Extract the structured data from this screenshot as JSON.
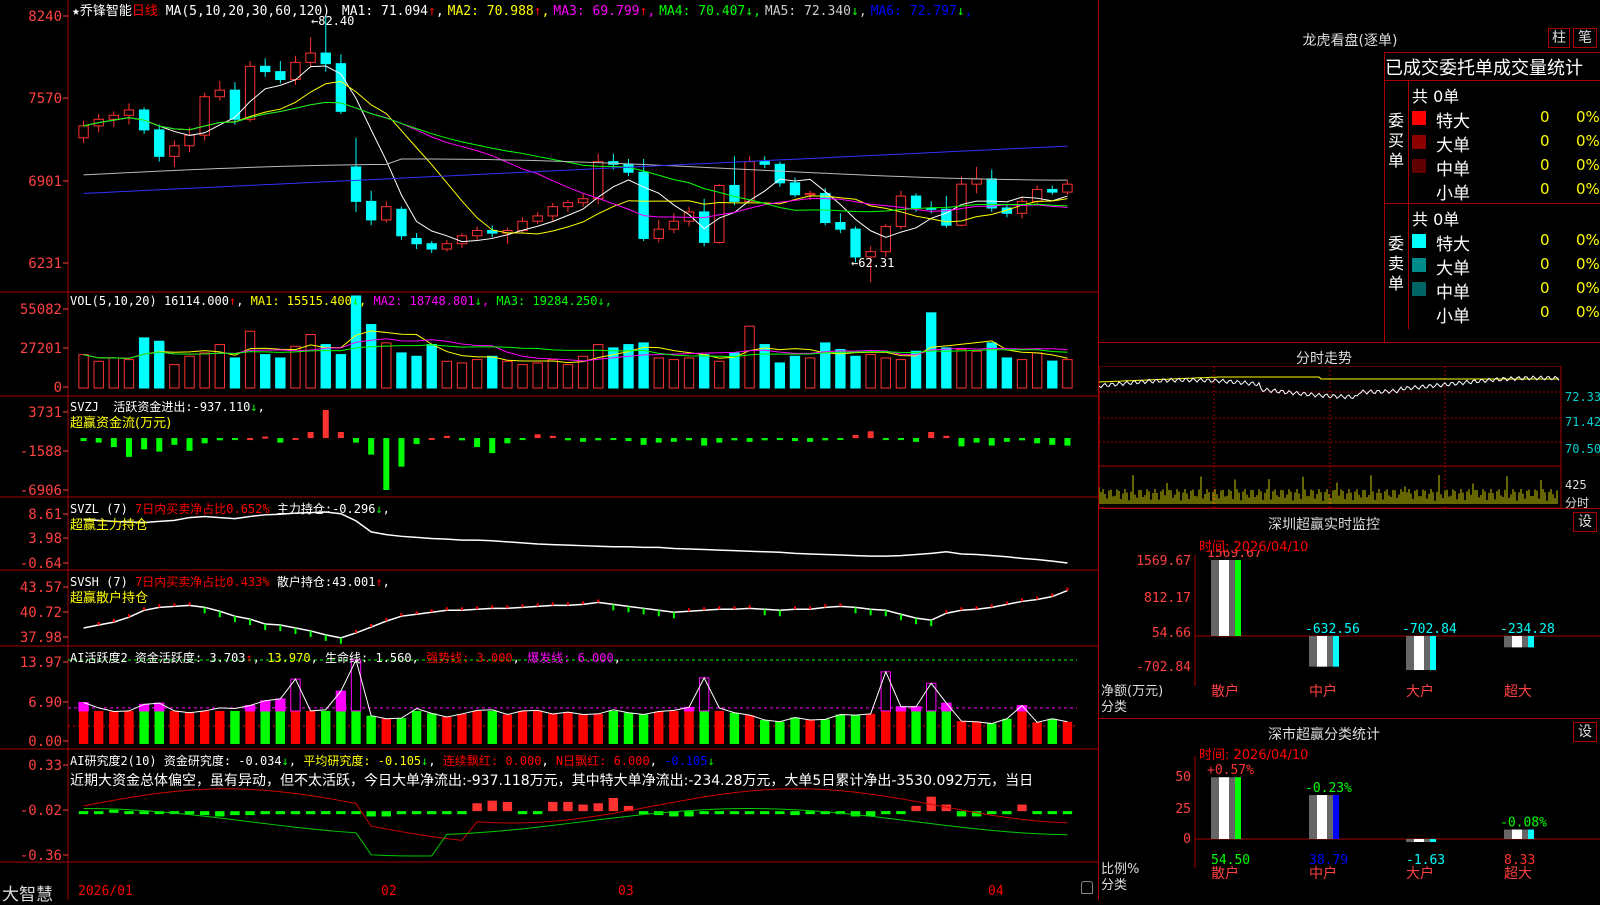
{
  "stock": {
    "name": "乔锋智能",
    "period": "日线",
    "star": "★",
    "ma_label": "MA(5,10,20,30,60,120)"
  },
  "ma": [
    {
      "label": "MA1:",
      "value": "71.094",
      "arrow": "↑",
      "color": "#ffffff"
    },
    {
      "label": "MA2:",
      "value": "70.988",
      "arrow": "↑",
      "color": "#ffff00"
    },
    {
      "label": "MA3:",
      "value": "69.799",
      "arrow": "↑",
      "color": "#ff00ff"
    },
    {
      "label": "MA4:",
      "value": "70.407",
      "arrow": "↓",
      "color": "#00ff00"
    },
    {
      "label": "MA5:",
      "value": "72.340",
      "arrow": "↓",
      "color": "#cccccc"
    },
    {
      "label": "MA6:",
      "value": "72.797",
      "arrow": "↓",
      "color": "#0000ff"
    }
  ],
  "price_axis": [
    "8240",
    "7570",
    "6901",
    "6231"
  ],
  "price_marks": {
    "high": "82.40",
    "low": "62.31"
  },
  "vol": {
    "label": "VOL(5,10,20)",
    "value": "16114.000",
    "arrow": "↑",
    "ma": [
      {
        "t": "MA1:",
        "v": "15515.400",
        "a": "↓",
        "c": "#ffff00"
      },
      {
        "t": "MA2:",
        "v": "18748.801",
        "a": "↓",
        "c": "#ff00ff"
      },
      {
        "t": "MA3:",
        "v": "19284.250",
        "a": "↓",
        "c": "#00ff00"
      }
    ],
    "axis": [
      "55082",
      "27201",
      "0"
    ]
  },
  "svzj": {
    "label": "SVZJ",
    "text": "活跃资金进出:",
    "value": "-937.110",
    "arrow": "↓",
    "sub": "超赢资金流(万元)",
    "axis": [
      "3731",
      "-1588",
      "-6906"
    ]
  },
  "svzl": {
    "label": "SVZL (7)",
    "ratio": "7日内买卖净占比0.652%",
    "text": "主力持仓:",
    "value": "-0.296",
    "arrow": "↓",
    "sub": "超赢主力持仓",
    "axis": [
      "8.61",
      "3.98",
      "-0.64"
    ]
  },
  "svsh": {
    "label": "SVSH (7)",
    "ratio": "7日内买卖净占比0.433%",
    "text": "散户持仓:",
    "value": "43.001",
    "arrow": "↑",
    "sub": "超赢散户持仓",
    "axis": [
      "43.57",
      "40.72",
      "37.98"
    ]
  },
  "ai_active": {
    "label": "AI活跃度2",
    "text": "资金活跃度:",
    "value": "3.703",
    "arrow": "↑",
    "v2": "13.970",
    "life": "生命线:",
    "life_v": "1.560",
    "strong": "强势线:",
    "strong_v": "3.000",
    "burst": "爆发线:",
    "burst_v": "6.000",
    "axis": [
      "13.97",
      "6.90",
      "0.00"
    ]
  },
  "ai_research": {
    "label": "AI研究度2(10)",
    "text": "资金研究度:",
    "value": "-0.034",
    "arrow": "↓",
    "avg": "平均研究度:",
    "avg_v": "-0.105",
    "red": "连续飘红:",
    "red_v": "0.000",
    "nred": "N日飘红:",
    "nred_v": "6.000",
    "extra": "-0.105",
    "commentary": "近期大资金总体偏空，虽有异动，但不太活跃，今日大单净流出:-937.118万元，其中特大单净流出:-234.28万元，大单5日累计净出-3530.092万元，当日",
    "axis": [
      "0.33",
      "-0.02",
      "-0.36"
    ]
  },
  "bottom": {
    "brand": "大智慧",
    "dates": [
      "2026/01",
      "02",
      "03",
      "04"
    ]
  },
  "panel": {
    "title": "龙虎看盘(逐单)",
    "tab_bar": "柱",
    "tab_pen": "笔",
    "header": "已成交委托单成交量统计",
    "buy": {
      "side": "委买单",
      "total": "共 0单",
      "rows": [
        {
          "name": "特大",
          "count": "0",
          "pct": "0%",
          "color": "#ff0000"
        },
        {
          "name": "大单",
          "count": "0",
          "pct": "0%",
          "color": "#8b0000"
        },
        {
          "name": "中单",
          "count": "0",
          "pct": "0%",
          "color": "#600000"
        },
        {
          "name": "小单",
          "count": "0",
          "pct": "0%",
          "color": "#000000"
        }
      ]
    },
    "sell": {
      "side": "委卖单",
      "total": "共 0单",
      "rows": [
        {
          "name": "特大",
          "count": "0",
          "pct": "0%",
          "color": "#00ffff"
        },
        {
          "name": "大单",
          "count": "0",
          "pct": "0%",
          "color": "#008b8b"
        },
        {
          "name": "中单",
          "count": "0",
          "pct": "0%",
          "color": "#006464"
        },
        {
          "name": "小单",
          "count": "0",
          "pct": "0%",
          "color": "#000000"
        }
      ]
    }
  },
  "intraday": {
    "title": "分时走势",
    "axis": [
      "72.33",
      "71.42",
      "70.50"
    ],
    "vol_label": "425",
    "vol_unit": "分时"
  },
  "sz_monitor": {
    "title": "深圳超赢实时监控",
    "set": "设",
    "time_label": "时间: 2026/04/10",
    "axis": [
      "1569.67",
      "812.17",
      "54.66",
      "-702.84"
    ],
    "unit": "净额(万元)",
    "cat": "分类",
    "bars": [
      {
        "cat": "散户",
        "value": "1569.67"
      },
      {
        "cat": "中户",
        "value": "-632.56"
      },
      {
        "cat": "大户",
        "value": "-702.84"
      },
      {
        "cat": "超大",
        "value": "-234.28"
      }
    ]
  },
  "sz_class": {
    "title": "深市超赢分类统计",
    "set": "设",
    "time_label": "时间: 2026/04/10",
    "axis": [
      "75",
      "50",
      "25",
      "0"
    ],
    "unit": "比例%",
    "cat": "分类",
    "bars": [
      {
        "cat": "散户",
        "value": "54.50",
        "change": "+0.57%"
      },
      {
        "cat": "中户",
        "value": "38.79",
        "change": "-0.23%"
      },
      {
        "cat": "大户",
        "value": "-1.63",
        "change": ""
      },
      {
        "cat": "超大",
        "value": "8.33",
        "change": "-0.08%"
      }
    ]
  },
  "chart_data": [
    {
      "type": "candlestick",
      "title": "乔锋智能 日线",
      "ylim": [
        62.31,
        82.4
      ],
      "ohlc": [
        [
          73.2,
          74.5,
          72.8,
          74.1
        ],
        [
          74.1,
          75.0,
          73.6,
          74.6
        ],
        [
          74.6,
          75.2,
          74.0,
          74.9
        ],
        [
          74.9,
          75.8,
          74.2,
          75.3
        ],
        [
          75.3,
          75.5,
          73.5,
          73.8
        ],
        [
          73.8,
          74.2,
          71.4,
          71.8
        ],
        [
          71.8,
          73.0,
          71.0,
          72.6
        ],
        [
          72.6,
          74.0,
          72.1,
          73.4
        ],
        [
          73.4,
          76.6,
          73.0,
          76.3
        ],
        [
          76.3,
          77.5,
          76.0,
          76.8
        ],
        [
          76.8,
          77.4,
          74.2,
          74.6
        ],
        [
          74.6,
          79.0,
          74.4,
          78.6
        ],
        [
          78.6,
          79.2,
          77.8,
          78.2
        ],
        [
          78.2,
          79.0,
          77.3,
          77.6
        ],
        [
          77.6,
          79.4,
          77.2,
          78.9
        ],
        [
          78.9,
          80.8,
          78.5,
          79.6
        ],
        [
          79.6,
          82.4,
          78.2,
          78.8
        ],
        [
          78.8,
          79.5,
          75.0,
          75.2
        ],
        [
          71.0,
          73.2,
          67.6,
          68.4
        ],
        [
          68.4,
          69.2,
          66.6,
          67.0
        ],
        [
          67.0,
          68.4,
          66.8,
          68.0
        ],
        [
          67.8,
          68.0,
          65.5,
          65.8
        ],
        [
          65.6,
          66.0,
          64.8,
          65.2
        ],
        [
          65.2,
          65.4,
          64.5,
          64.8
        ],
        [
          64.8,
          65.5,
          64.6,
          65.2
        ],
        [
          65.2,
          66.0,
          64.9,
          65.8
        ],
        [
          65.8,
          66.5,
          65.5,
          66.2
        ],
        [
          66.2,
          66.6,
          65.7,
          66.0
        ],
        [
          66.0,
          66.4,
          65.2,
          66.2
        ],
        [
          66.2,
          67.2,
          66.0,
          66.9
        ],
        [
          66.9,
          67.6,
          66.7,
          67.3
        ],
        [
          67.3,
          68.3,
          66.9,
          68.0
        ],
        [
          68.0,
          68.5,
          67.6,
          68.3
        ],
        [
          68.3,
          69.0,
          68.0,
          68.6
        ],
        [
          68.6,
          72.0,
          68.2,
          71.4
        ],
        [
          71.4,
          72.0,
          70.8,
          71.2
        ],
        [
          71.2,
          71.6,
          70.3,
          70.6
        ],
        [
          70.6,
          71.6,
          65.4,
          65.6
        ],
        [
          65.6,
          67.0,
          65.3,
          66.3
        ],
        [
          66.3,
          67.5,
          66.0,
          66.9
        ],
        [
          66.9,
          68.0,
          66.5,
          67.6
        ],
        [
          67.6,
          68.6,
          65.0,
          65.3
        ],
        [
          65.3,
          69.7,
          65.2,
          69.6
        ],
        [
          69.6,
          71.8,
          68.1,
          68.4
        ],
        [
          68.4,
          71.8,
          68.6,
          71.4
        ],
        [
          71.4,
          71.8,
          70.9,
          71.2
        ],
        [
          71.2,
          71.4,
          69.5,
          69.8
        ],
        [
          69.8,
          70.2,
          68.7,
          68.9
        ],
        [
          68.9,
          69.2,
          68.5,
          69.0
        ],
        [
          69.0,
          69.4,
          66.6,
          66.8
        ],
        [
          66.8,
          67.5,
          66.0,
          66.3
        ],
        [
          66.3,
          66.5,
          63.8,
          64.2
        ],
        [
          64.2,
          65.0,
          62.31,
          64.6
        ],
        [
          64.6,
          66.7,
          64.2,
          66.5
        ],
        [
          66.5,
          69.2,
          66.3,
          68.8
        ],
        [
          68.8,
          69.0,
          67.6,
          67.9
        ],
        [
          67.9,
          68.4,
          67.5,
          67.8
        ],
        [
          67.8,
          68.8,
          66.4,
          66.6
        ],
        [
          66.6,
          70.3,
          66.5,
          69.7
        ],
        [
          69.7,
          71.0,
          69.0,
          70.1
        ],
        [
          70.1,
          70.8,
          67.6,
          67.9
        ],
        [
          67.9,
          68.2,
          67.2,
          67.5
        ],
        [
          67.5,
          68.7,
          67.1,
          68.4
        ],
        [
          68.4,
          69.6,
          68.2,
          69.3
        ],
        [
          69.3,
          69.6,
          68.9,
          69.1
        ],
        [
          69.1,
          70.0,
          68.9,
          69.7
        ]
      ]
    },
    {
      "type": "bar",
      "title": "VOL",
      "values": [
        20000,
        16000,
        18000,
        17000,
        30000,
        28000,
        14000,
        19000,
        21000,
        26000,
        18000,
        34000,
        20000,
        18000,
        25000,
        32000,
        26000,
        20000,
        55082,
        38000,
        27000,
        21000,
        19000,
        26000,
        16000,
        15000,
        17000,
        19000,
        16000,
        14000,
        15000,
        17000,
        14000,
        19000,
        26000,
        24000,
        26000,
        27000,
        18000,
        17000,
        18000,
        20000,
        16000,
        21000,
        37000,
        26000,
        15000,
        19000,
        18000,
        27000,
        23000,
        19000,
        20000,
        18000,
        17000,
        22000,
        45000,
        24000,
        23000,
        22000,
        27000,
        18000,
        17000,
        21000,
        16114,
        17000
      ]
    },
    {
      "type": "bar",
      "title": "超赢资金流(万元)",
      "values": [
        -400,
        -600,
        -1200,
        -2500,
        -1500,
        -1800,
        -900,
        -1700,
        -700,
        -300,
        -100,
        0,
        200,
        -600,
        0,
        800,
        3731,
        800,
        -600,
        -2200,
        -6906,
        -3800,
        -800,
        0,
        300,
        -300,
        -1200,
        -2000,
        -700,
        -200,
        500,
        300,
        -300,
        -500,
        -300,
        -200,
        -400,
        -900,
        -600,
        -500,
        -300,
        -1000,
        -600,
        -300,
        -500,
        -300,
        -200,
        -400,
        -500,
        -300,
        -200,
        400,
        900,
        -200,
        -100,
        -500,
        800,
        300,
        -1100,
        -600,
        -1000,
        -500,
        -300,
        -700,
        -900,
        -1000
      ]
    },
    {
      "type": "line",
      "title": "超赢主力持仓",
      "values": [
        7.2,
        7.1,
        6.9,
        6.8,
        6.7,
        6.9,
        7.1,
        7.6,
        7.8,
        7.6,
        7.4,
        7.8,
        8.1,
        8.2,
        8.4,
        8.5,
        8.61,
        8.3,
        7.0,
        5.0,
        4.5,
        4.2,
        4.0,
        3.8,
        3.7,
        3.5,
        3.5,
        3.4,
        3.2,
        3.0,
        2.8,
        2.7,
        2.6,
        2.5,
        2.4,
        2.3,
        2.3,
        2.2,
        2.2,
        2.0,
        1.9,
        1.8,
        1.7,
        1.6,
        1.5,
        1.4,
        1.3,
        1.1,
        1.0,
        0.9,
        0.8,
        0.7,
        0.6,
        0.6,
        0.7,
        0.9,
        1.1,
        1.4,
        1.0,
        0.9,
        0.7,
        0.5,
        0.2,
        0.0,
        -0.3,
        -0.64
      ]
    },
    {
      "type": "line",
      "title": "超赢散户持仓",
      "values": [
        39.2,
        39.5,
        39.8,
        40.3,
        41.0,
        41.3,
        41.4,
        41.5,
        41.3,
        40.9,
        40.4,
        40.1,
        39.6,
        39.5,
        39.2,
        38.9,
        38.5,
        38.2,
        38.7,
        39.3,
        39.9,
        40.4,
        40.6,
        40.8,
        41.0,
        41.0,
        41.1,
        41.2,
        41.2,
        41.3,
        41.4,
        41.5,
        41.5,
        41.6,
        41.8,
        41.6,
        41.4,
        41.2,
        41.0,
        40.8,
        40.9,
        41.0,
        41.1,
        41.1,
        41.2,
        41.1,
        41.0,
        41.1,
        41.1,
        41.3,
        41.4,
        41.3,
        41.1,
        41.0,
        40.6,
        40.2,
        40.0,
        40.7,
        41.0,
        41.1,
        41.3,
        41.6,
        41.9,
        42.1,
        42.4,
        43.0
      ]
    },
    {
      "type": "bar",
      "title": "资金活跃度",
      "values": [
        6.9,
        6.0,
        5.4,
        5.5,
        6.6,
        6.8,
        5.5,
        5.2,
        5.5,
        6.0,
        5.9,
        6.4,
        7.2,
        7.5,
        10.8,
        5.5,
        5.7,
        8.8,
        13.97,
        4.7,
        4.2,
        4.3,
        5.9,
        5.1,
        4.5,
        5.0,
        5.6,
        5.7,
        4.9,
        5.5,
        5.6,
        5.0,
        5.3,
        4.9,
        5.0,
        5.7,
        5.2,
        4.9,
        5.4,
        5.6,
        6.1,
        11.0,
        6.0,
        5.2,
        4.8,
        4.0,
        3.7,
        4.4,
        4.0,
        4.1,
        4.9,
        4.8,
        5.0,
        12.0,
        6.2,
        6.2,
        10.1,
        6.8,
        3.8,
        3.7,
        3.4,
        4.2,
        6.4,
        3.6,
        4.2,
        3.7
      ]
    },
    {
      "type": "bar",
      "title": "资金研究度",
      "values": [
        -0.04,
        -0.03,
        -0.01,
        -0.03,
        -0.03,
        -0.02,
        -0.03,
        -0.03,
        -0.05,
        -0.06,
        -0.05,
        -0.05,
        -0.03,
        -0.03,
        -0.03,
        -0.02,
        -0.02,
        -0.03,
        -0.04,
        -0.06,
        -0.06,
        -0.03,
        -0.03,
        -0.02,
        -0.03,
        -0.03,
        0.04,
        0.06,
        0.05,
        -0.04,
        -0.03,
        0.05,
        0.05,
        0.03,
        0.04,
        0.08,
        0.02,
        -0.03,
        -0.05,
        -0.06,
        -0.06,
        -0.04,
        -0.04,
        -0.02,
        -0.02,
        -0.03,
        -0.04,
        -0.05,
        -0.04,
        -0.03,
        -0.04,
        -0.06,
        -0.06,
        -0.04,
        -0.04,
        0.02,
        0.09,
        0.03,
        -0.06,
        -0.06,
        -0.04,
        -0.03,
        0.03,
        -0.02,
        -0.04,
        -0.03
      ]
    },
    {
      "type": "bar",
      "title": "深圳超赢实时监控",
      "categories": [
        "散户",
        "中户",
        "大户",
        "超大"
      ],
      "values": [
        1569.67,
        -632.56,
        -702.84,
        -234.28
      ],
      "ylabel": "净额(万元)",
      "ylim": [
        -702.84,
        1569.67
      ]
    },
    {
      "type": "bar",
      "title": "深市超赢分类统计",
      "categories": [
        "散户",
        "中户",
        "大户",
        "超大"
      ],
      "values": [
        54.5,
        38.79,
        -1.63,
        8.33
      ],
      "ylabel": "比例%",
      "ylim": [
        0,
        75
      ]
    }
  ]
}
